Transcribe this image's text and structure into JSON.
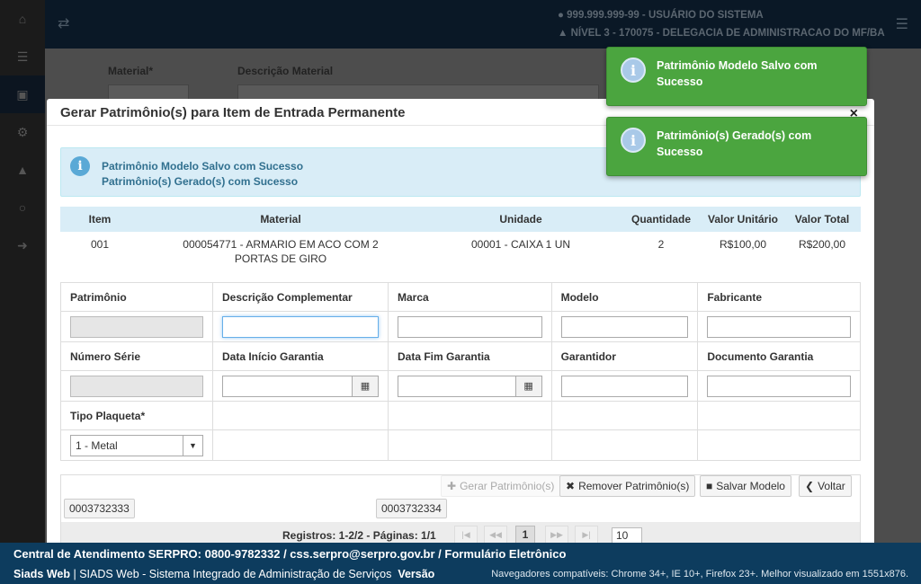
{
  "header": {
    "user_id_line": "999.999.999-99 - USUÁRIO DO SISTEMA",
    "level_line": "NÍVEL 3 - 170075 - DELEGACIA DE ADMINISTRACAO DO MF/BA"
  },
  "background_form": {
    "material_label": "Material*",
    "descricao_label": "Descrição Material"
  },
  "modal": {
    "title": "Gerar Patrimônio(s) para Item de Entrada Permanente",
    "close": "×",
    "info_messages": [
      "Patrimônio Modelo Salvo com Sucesso",
      "Patrimônio(s) Gerado(s) com Sucesso"
    ]
  },
  "items_table": {
    "headers": [
      "Item",
      "Material",
      "Unidade",
      "Quantidade",
      "Valor Unitário",
      "Valor Total"
    ],
    "row": [
      "001",
      "000054771 - ARMARIO EM ACO COM 2 PORTAS DE GIRO",
      "00001 - CAIXA 1 UN",
      "2",
      "R$100,00",
      "R$200,00"
    ]
  },
  "form": {
    "labels_row1": [
      "Patrimônio",
      "Descrição Complementar",
      "Marca",
      "Modelo",
      "Fabricante"
    ],
    "labels_row2": [
      "Número Série",
      "Data Início Garantia",
      "Data Fim Garantia",
      "Garantidor",
      "Documento Garantia"
    ],
    "labels_row3": [
      "Tipo Plaqueta*"
    ],
    "tipo_plaqueta_value": "1 - Metal"
  },
  "actions": {
    "gerar": "Gerar Patrimônio(s)",
    "remover": "Remover Patrimônio(s)",
    "salvar": "Salvar Modelo",
    "voltar": "Voltar"
  },
  "patrimonios": [
    "0003732333",
    "0003732334"
  ],
  "pager": {
    "registros": "Registros: 1-2/2 - Páginas: 1/1",
    "current_page": "1",
    "rows_per_page": "10"
  },
  "toasts": [
    "Patrimônio Modelo Salvo com Sucesso",
    "Patrimônio(s) Gerado(s) com Sucesso"
  ],
  "footer": {
    "line1": "Central de Atendimento SERPRO: 0800-9782332 / css.serpro@serpro.gov.br / Formulário Eletrônico",
    "app_name": "Siads Web",
    "app_desc": "| SIADS Web - Sistema Integrado de Administração de Serviços",
    "version_label": "Versão",
    "browsers": "Navegadores compatíveis: Chrome 34+, IE 10+, Firefox 23+. Melhor visualizado em 1551x876."
  },
  "colors": {
    "header_bg": "#0a1826",
    "footer_bg": "#0d3c5e",
    "toast_bg": "#4ba53f",
    "info_bg": "#d9edf7"
  }
}
